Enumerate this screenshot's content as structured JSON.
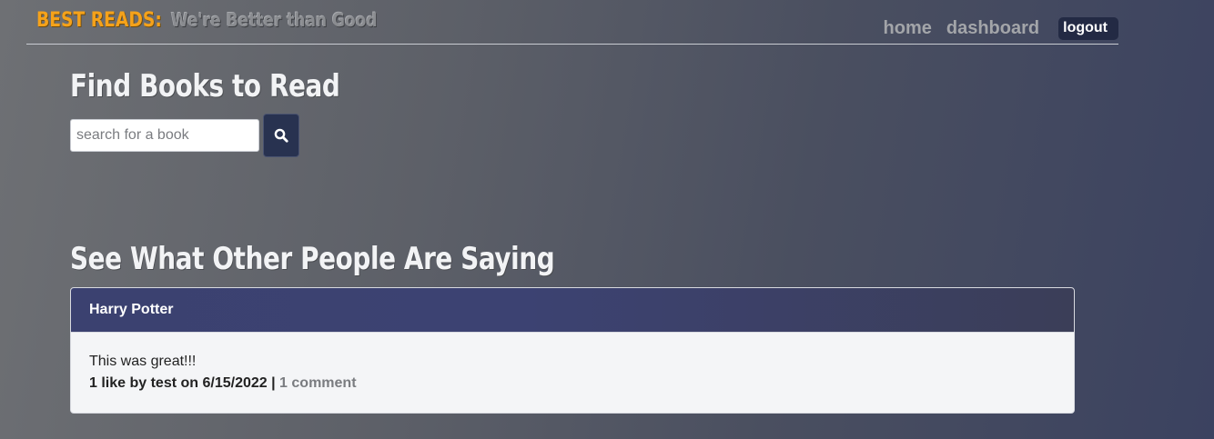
{
  "header": {
    "brand_name": "BEST READS:",
    "tagline": "We're Better than Good",
    "nav": {
      "home": "home",
      "dashboard": "dashboard",
      "logout": "logout"
    }
  },
  "search": {
    "title": "Find Books to Read",
    "placeholder": "search for a book",
    "value": "",
    "button_icon": "search-icon"
  },
  "reviews": {
    "title": "See What Other People Are Saying",
    "items": [
      {
        "book": "Harry Potter",
        "text": "This was great!!!",
        "likes": "1 like by test on 6/15/2022",
        "separator": " | ",
        "comments": "1 comment"
      }
    ]
  },
  "colors": {
    "brand": "#f5a21a",
    "accent_dark": "#283250",
    "card_header": "#3b4170"
  }
}
